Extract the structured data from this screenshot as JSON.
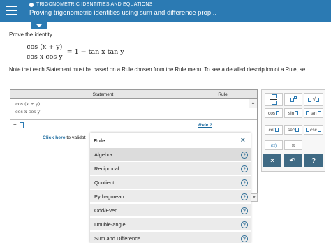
{
  "header": {
    "topic": "TRIGONOMETRIC IDENTITIES AND EQUATIONS",
    "title": "Proving trigonometric identities using sum and difference prop..."
  },
  "problem": {
    "prompt": "Prove the identity.",
    "lhs_numerator": "cos (x + y)",
    "lhs_denominator": "cos x cos y",
    "rhs": "= 1 − tan x tan y",
    "note": "Note that each Statement must be based on a Rule chosen from the Rule menu. To see a detailed description of a Rule, se"
  },
  "proof_table": {
    "col_statement": "Statement",
    "col_rule": "Rule",
    "row1_numerator": "cos (x + y)",
    "row1_denominator": "cos x cos y",
    "row2_prefix": "=",
    "row2_rule_link": "Rule ?"
  },
  "footer_link": {
    "link_text": "Click here",
    "rest_text": " to validat"
  },
  "rule_menu": {
    "title": "Rule",
    "close_symbol": "×",
    "items": [
      {
        "label": "Algebra"
      },
      {
        "label": "Reciprocal"
      },
      {
        "label": "Quotient"
      },
      {
        "label": "Pythagorean"
      },
      {
        "label": "Odd/Even"
      },
      {
        "label": "Double-angle"
      },
      {
        "label": "Sum and Difference"
      }
    ],
    "help_symbol": "?"
  },
  "keypad": {
    "cos": "cos",
    "sin": "sin",
    "tan": "tan",
    "cot": "cot",
    "sec": "sec",
    "csc": "csc",
    "pi": "π",
    "times": "×",
    "undo": "↶",
    "help": "?"
  },
  "colors": {
    "header": "#2b7ab3",
    "link": "#1b6a9e",
    "dark_button": "#3f6a84"
  }
}
